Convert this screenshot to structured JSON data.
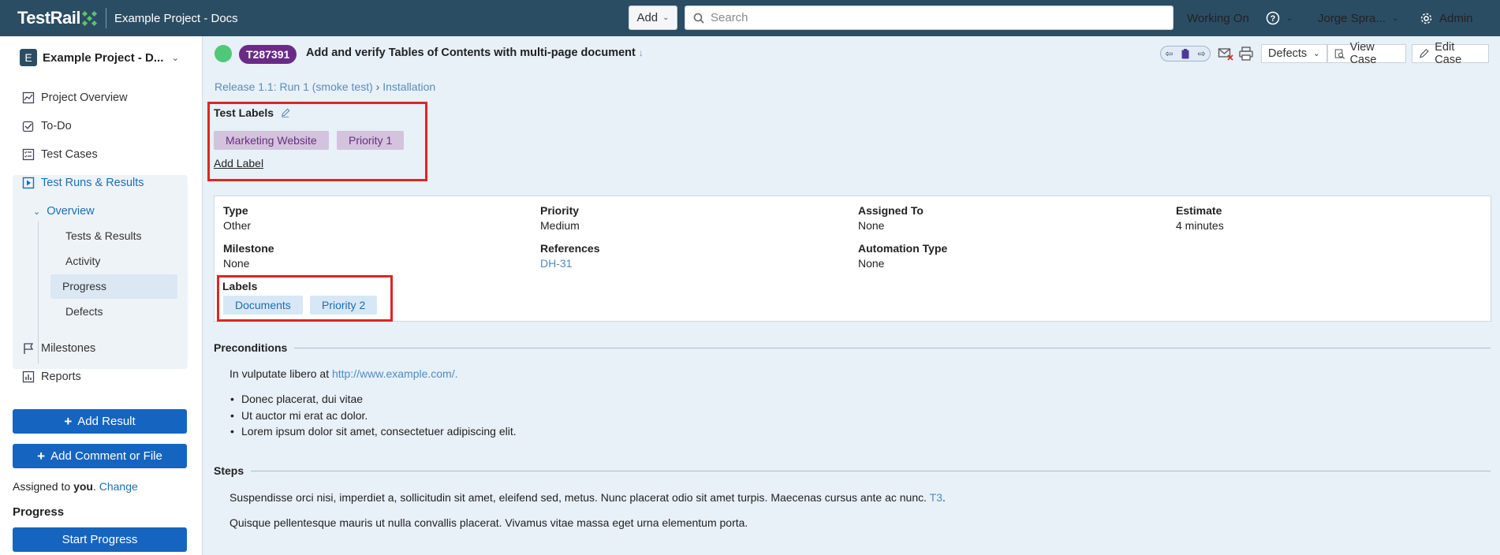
{
  "app": {
    "logo_text": "TestRail",
    "project_title": "Example Project - Docs",
    "add_label": "Add",
    "search_placeholder": "Search",
    "working_on": "Working On",
    "user_name": "Jorge Spra...",
    "admin_label": "Admin",
    "accent": "#2b4d63",
    "brand_green": "#5cc26b"
  },
  "sidebar": {
    "project_badge": "E",
    "project_name": "Example Project - D...",
    "items": {
      "overview": "Project Overview",
      "todo": "To-Do",
      "test_cases": "Test Cases",
      "test_runs": "Test Runs & Results",
      "overview_sub": "Overview",
      "tests_results": "Tests & Results",
      "activity": "Activity",
      "progress": "Progress",
      "defects": "Defects",
      "milestones": "Milestones",
      "reports": "Reports"
    },
    "add_result": "Add Result",
    "add_comment": "Add Comment or File",
    "assigned_prefix": "Assigned to",
    "assigned_user": "you",
    "assigned_change": "Change",
    "progress_heading": "Progress",
    "start_progress": "Start Progress"
  },
  "header": {
    "status_color": "#50c878",
    "test_id": "T287391",
    "title": "Add and verify Tables of Contents with multi-page document",
    "defects_label": "Defects",
    "view_case": "View Case",
    "edit_case": "Edit Case"
  },
  "breadcrumb": {
    "run": "Release 1.1: Run 1 (smoke test)",
    "sep": "›",
    "section": "Installation"
  },
  "test_labels": {
    "heading": "Test Labels",
    "chips": [
      "Marketing Website",
      "Priority 1"
    ],
    "add_label": "Add Label"
  },
  "properties": {
    "type_k": "Type",
    "type_v": "Other",
    "priority_k": "Priority",
    "priority_v": "Medium",
    "assigned_k": "Assigned To",
    "assigned_v": "None",
    "estimate_k": "Estimate",
    "estimate_v": "4 minutes",
    "milestone_k": "Milestone",
    "milestone_v": "None",
    "references_k": "References",
    "references_v": "DH-31",
    "automation_k": "Automation Type",
    "automation_v": "None",
    "labels_k": "Labels",
    "labels": [
      "Documents",
      "Priority 2"
    ]
  },
  "preconditions": {
    "heading": "Preconditions",
    "intro": "In vulputate libero at",
    "link": "http://www.example.com/.",
    "bullets": [
      "Donec placerat, dui vitae",
      "Ut auctor mi erat ac dolor.",
      "Lorem ipsum dolor sit amet, consectetuer adipiscing elit."
    ]
  },
  "steps": {
    "heading": "Steps",
    "line1": "Suspendisse orci nisi, imperdiet a, sollicitudin sit amet, eleifend sed, metus. Nunc placerat odio sit amet turpis. Maecenas cursus ante ac nunc.",
    "line1_link": "T3",
    "line1_end": ".",
    "line2": "Quisque pellentesque mauris ut nulla convallis placerat. Vivamus vitae massa eget urna elementum porta."
  }
}
